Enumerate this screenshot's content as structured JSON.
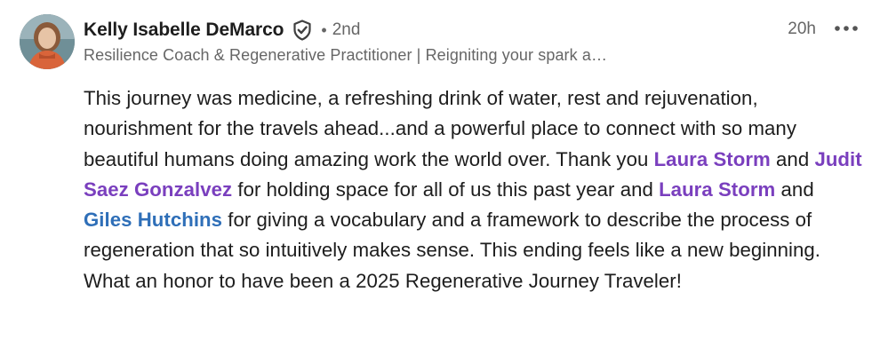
{
  "post": {
    "author": {
      "name": "Kelly Isabelle DeMarco",
      "connection_degree": "2nd",
      "separator": "•",
      "headline": "Resilience Coach & Regenerative Practitioner | Reigniting your spark a…"
    },
    "timestamp": "20h",
    "icons": {
      "verified": "verified-shield-icon",
      "more": "more-horizontal-icon"
    },
    "body": {
      "p1": "This journey was medicine, a refreshing drink of water, rest and rejuvenation, nourishment for the travels ahead...and a powerful place to connect with so many beautiful humans doing amazing work the world over. Thank you ",
      "mention1": "Laura Storm",
      "p2": " and ",
      "mention2": "Judit Saez Gonzalvez",
      "p3": " for holding space for all of us this past year and ",
      "mention3": "Laura Storm",
      "p4": " and ",
      "mention4": "Giles Hutchins",
      "p5": " for giving a vocabulary and a framework to describe the process of regeneration that so intuitively makes sense. This ending feels like a new beginning. What an honor to have been a 2025 Regenerative Journey Traveler!"
    },
    "colors": {
      "mention_purple": "#7a3fbe",
      "mention_blue": "#2f6fb8",
      "secondary_text": "#666666",
      "primary_text": "#1d1d1d"
    }
  }
}
